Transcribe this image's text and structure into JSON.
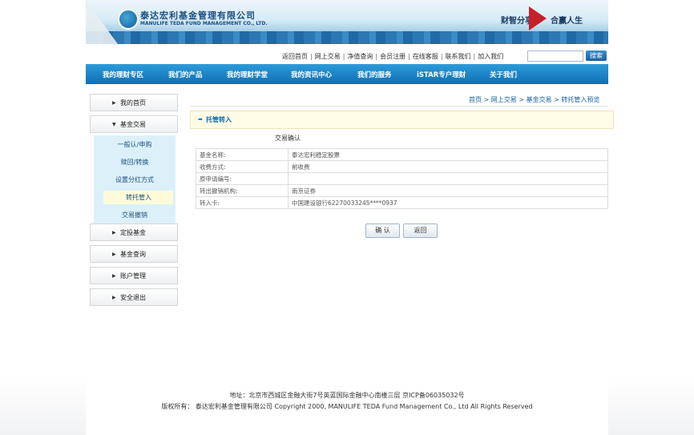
{
  "header": {
    "logo_cn": "泰达宏利基金管理有限公司",
    "logo_en": "MANULIFE TEDA FUND MANAGEMENT CO., LTD.",
    "slogan_left": "财智分享",
    "slogan_right": "合赢人生"
  },
  "toplinks": [
    "返回首页",
    "网上交易",
    "净值查询",
    "会员注册",
    "在线客服",
    "联系我们",
    "加入我们"
  ],
  "search": {
    "button": "搜索",
    "value": ""
  },
  "nav": [
    "我的理财专区",
    "我们的产品",
    "我的理财学堂",
    "我的资讯中心",
    "我们的服务",
    "iSTAR专户理财",
    "关于我们"
  ],
  "sidebar": {
    "home": "我的首页",
    "fund_trade": "基金交易",
    "sub_items": [
      "一般认/申购",
      "赎回/转换",
      "设置分红方式",
      "转托管入",
      "交易撤销"
    ],
    "active_index": 3,
    "fixed_invest": "定投基金",
    "fund_query": "基金查询",
    "account": "账户管理",
    "logout": "安全退出"
  },
  "breadcrumb": [
    "首页",
    "网上交易",
    "基金交易",
    "转托管入预览"
  ],
  "section_title": "托管转入",
  "confirm_title": "交易确认",
  "details": [
    {
      "label": "基金名称:",
      "value": "泰达宏利稳定股票"
    },
    {
      "label": "收费方式:",
      "value": "前收费"
    },
    {
      "label": "原申请编号:",
      "value": ""
    },
    {
      "label": "转出撤销机构:",
      "value": "南京证券"
    },
    {
      "label": "转入卡:",
      "value": "中国建设银行62270033245****0937"
    }
  ],
  "buttons": {
    "confirm": "确 认",
    "back": "返回"
  },
  "footer": {
    "address": "地址：北京市西城区金融大街7号英蓝国际金融中心南楼三层 京ICP备06035032号",
    "copyright": "版权所有：  泰达宏利基金管理有限公司  Copyright 2000, MANULIFE TEDA Fund Management Co., Ltd All Rights Reserved"
  },
  "colors": {
    "nav": "#1a84c7",
    "link": "#1a5fa3",
    "title_bg": "#fffbe6",
    "accent_red": "#c8202a"
  }
}
